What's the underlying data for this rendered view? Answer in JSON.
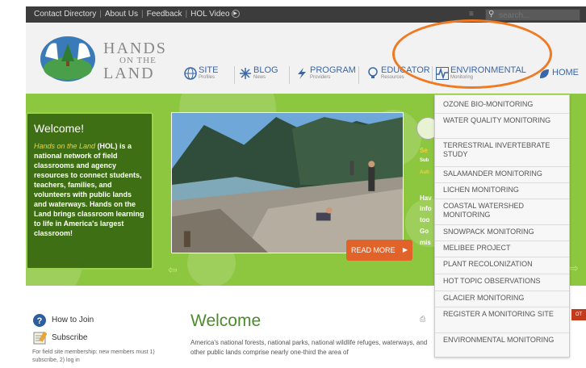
{
  "topbar": {
    "links": [
      "Contact Directory",
      "About Us",
      "Feedback",
      "HOL Video"
    ],
    "search_placeholder": "search..."
  },
  "logo": {
    "line1": "HANDS",
    "line2": "ON THE",
    "line3": "LAND"
  },
  "nav": [
    {
      "label": "SITE",
      "sub": "Profiles",
      "icon": "globe-icon"
    },
    {
      "label": "BLOG",
      "sub": "News",
      "icon": "snowflake-icon"
    },
    {
      "label": "PROGRAM",
      "sub": "Providers",
      "icon": "lightning-icon"
    },
    {
      "label": "EDUCATOR",
      "sub": "Resources",
      "icon": "lightbulb-icon"
    },
    {
      "label": "ENVIRONMENTAL",
      "sub": "Monitoring",
      "icon": "heartbeat-icon"
    },
    {
      "label": "HOME",
      "sub": "",
      "icon": "leaf-icon"
    }
  ],
  "welcome_box": {
    "title": "Welcome!",
    "highlight": "Hands on the Land",
    "body": " (HOL) is a national network of field classrooms and agency resources to connect students, teachers, families, and volunteers with public lands and waterways. Hands on the Land brings classroom learning to life in America's largest classroom!"
  },
  "hero": {
    "read_more": "READ MORE"
  },
  "side_fragments": [
    "Se",
    "Sub",
    "Auti",
    "Hav",
    "info",
    "too",
    "Go",
    "mis"
  ],
  "dropdown": [
    "OZONE BIO-MONITORING",
    "WATER QUALITY MONITORING",
    "TERRESTRIAL INVERTEBRATE STUDY",
    "SALAMANDER MONITORING",
    "LICHEN MONITORING",
    "COASTAL WATERSHED MONITORING",
    "SNOWPACK MONITORING",
    "MELIBEE PROJECT",
    "PLANT RECOLONIZATION",
    "HOT TOPIC OBSERVATIONS",
    "GLACIER MONITORING",
    "REGISTER A MONITORING SITE",
    "ENVIRONMENTAL MONITORING"
  ],
  "lower": {
    "how_to_join": "How to Join",
    "subscribe": "Subscribe",
    "side_note": "For field site membership: new members must 1) subscribe, 2) log in",
    "title": "Welcome",
    "body": "America's national forests, national parks, national wildlife refuges, waterways, and other public lands comprise nearly one-third the area of",
    "hot": "OT"
  },
  "colors": {
    "accent": "#8dc63f",
    "nav_blue": "#3a66a8",
    "highlight_oval": "#ef7a24",
    "dark_green": "#3f6f14"
  }
}
